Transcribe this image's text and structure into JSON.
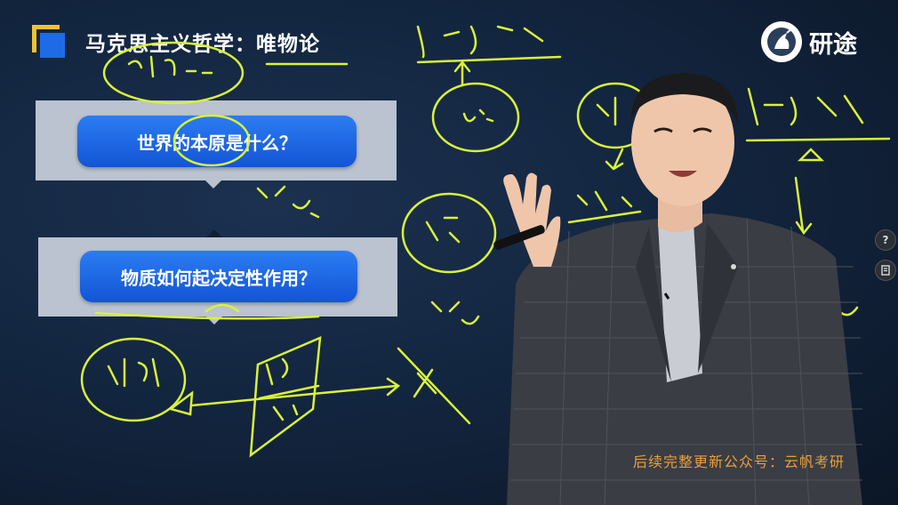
{
  "slide": {
    "title": "马克思主义哲学：唯物论",
    "question_1": "世界的本原是什么？",
    "question_2": "物质如何起决定性作用？"
  },
  "logo": {
    "brand": "研途",
    "icon": "unicorn-icon"
  },
  "controls": {
    "help_label": "?",
    "notes_icon": "note-icon"
  },
  "watermark": "后续完整更新公众号：云帆考研",
  "colors": {
    "accent_blue": "#1e6be6",
    "accent_yellow": "#f1c232",
    "chalk": "#d9f23a",
    "watermark": "#e8a03c"
  }
}
